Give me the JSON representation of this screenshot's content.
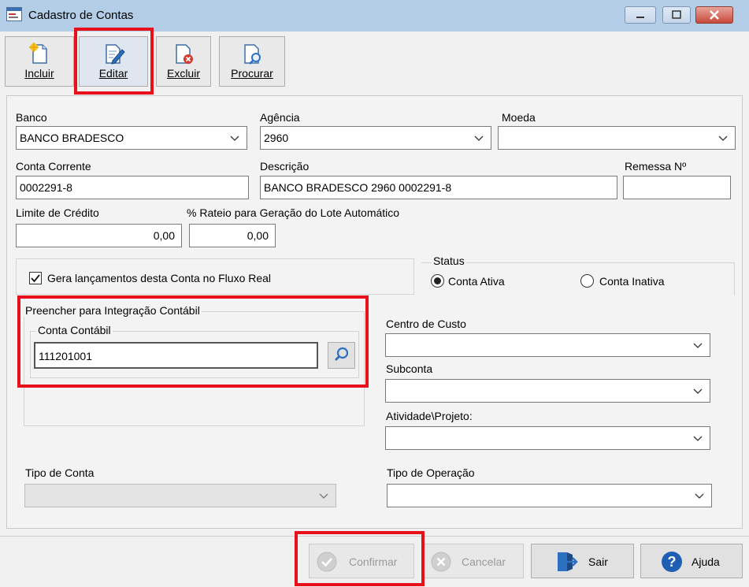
{
  "window": {
    "title": "Cadastro de Contas"
  },
  "toolbar": {
    "incluir": "Incluir",
    "editar": "Editar",
    "excluir": "Excluir",
    "procurar": "Procurar"
  },
  "form": {
    "banco": {
      "label": "Banco",
      "value": "BANCO BRADESCO"
    },
    "agencia": {
      "label": "Agência",
      "value": "2960"
    },
    "moeda": {
      "label": "Moeda",
      "value": ""
    },
    "conta_corrente": {
      "label": "Conta Corrente",
      "value": "0002291-8"
    },
    "descricao": {
      "label": "Descrição",
      "value": "BANCO BRADESCO 2960 0002291-8"
    },
    "remessa": {
      "label": "Remessa Nº",
      "value": ""
    },
    "limite_credito": {
      "label": "Limite de Crédito",
      "value": "0,00"
    },
    "rateio": {
      "label": "% Rateio para Geração do Lote Automático",
      "value": "0,00"
    },
    "fluxo_real": {
      "label": "Gera lançamentos desta Conta no Fluxo Real",
      "checked": true
    },
    "status": {
      "title": "Status",
      "ativa": "Conta Ativa",
      "inativa": "Conta Inativa",
      "selected": "ativa"
    },
    "integracao": {
      "title": "Preencher para Integração Contábil",
      "conta_contabil": {
        "label": "Conta Contábil",
        "value": "111201001"
      }
    },
    "centro_custo": {
      "label": "Centro de Custo",
      "value": ""
    },
    "subconta": {
      "label": "Subconta",
      "value": ""
    },
    "atividade": {
      "label": "Atividade\\Projeto:",
      "value": ""
    },
    "tipo_conta": {
      "label": "Tipo de Conta",
      "value": ""
    },
    "tipo_operacao": {
      "label": "Tipo de Operação",
      "value": ""
    }
  },
  "buttons": {
    "confirmar": "Confirmar",
    "cancelar": "Cancelar",
    "sair": "Sair",
    "ajuda": "Ajuda"
  },
  "colors": {
    "highlight": "#e8101a",
    "titlebar": "#b3cde6",
    "help_blue": "#1e5fb4"
  }
}
